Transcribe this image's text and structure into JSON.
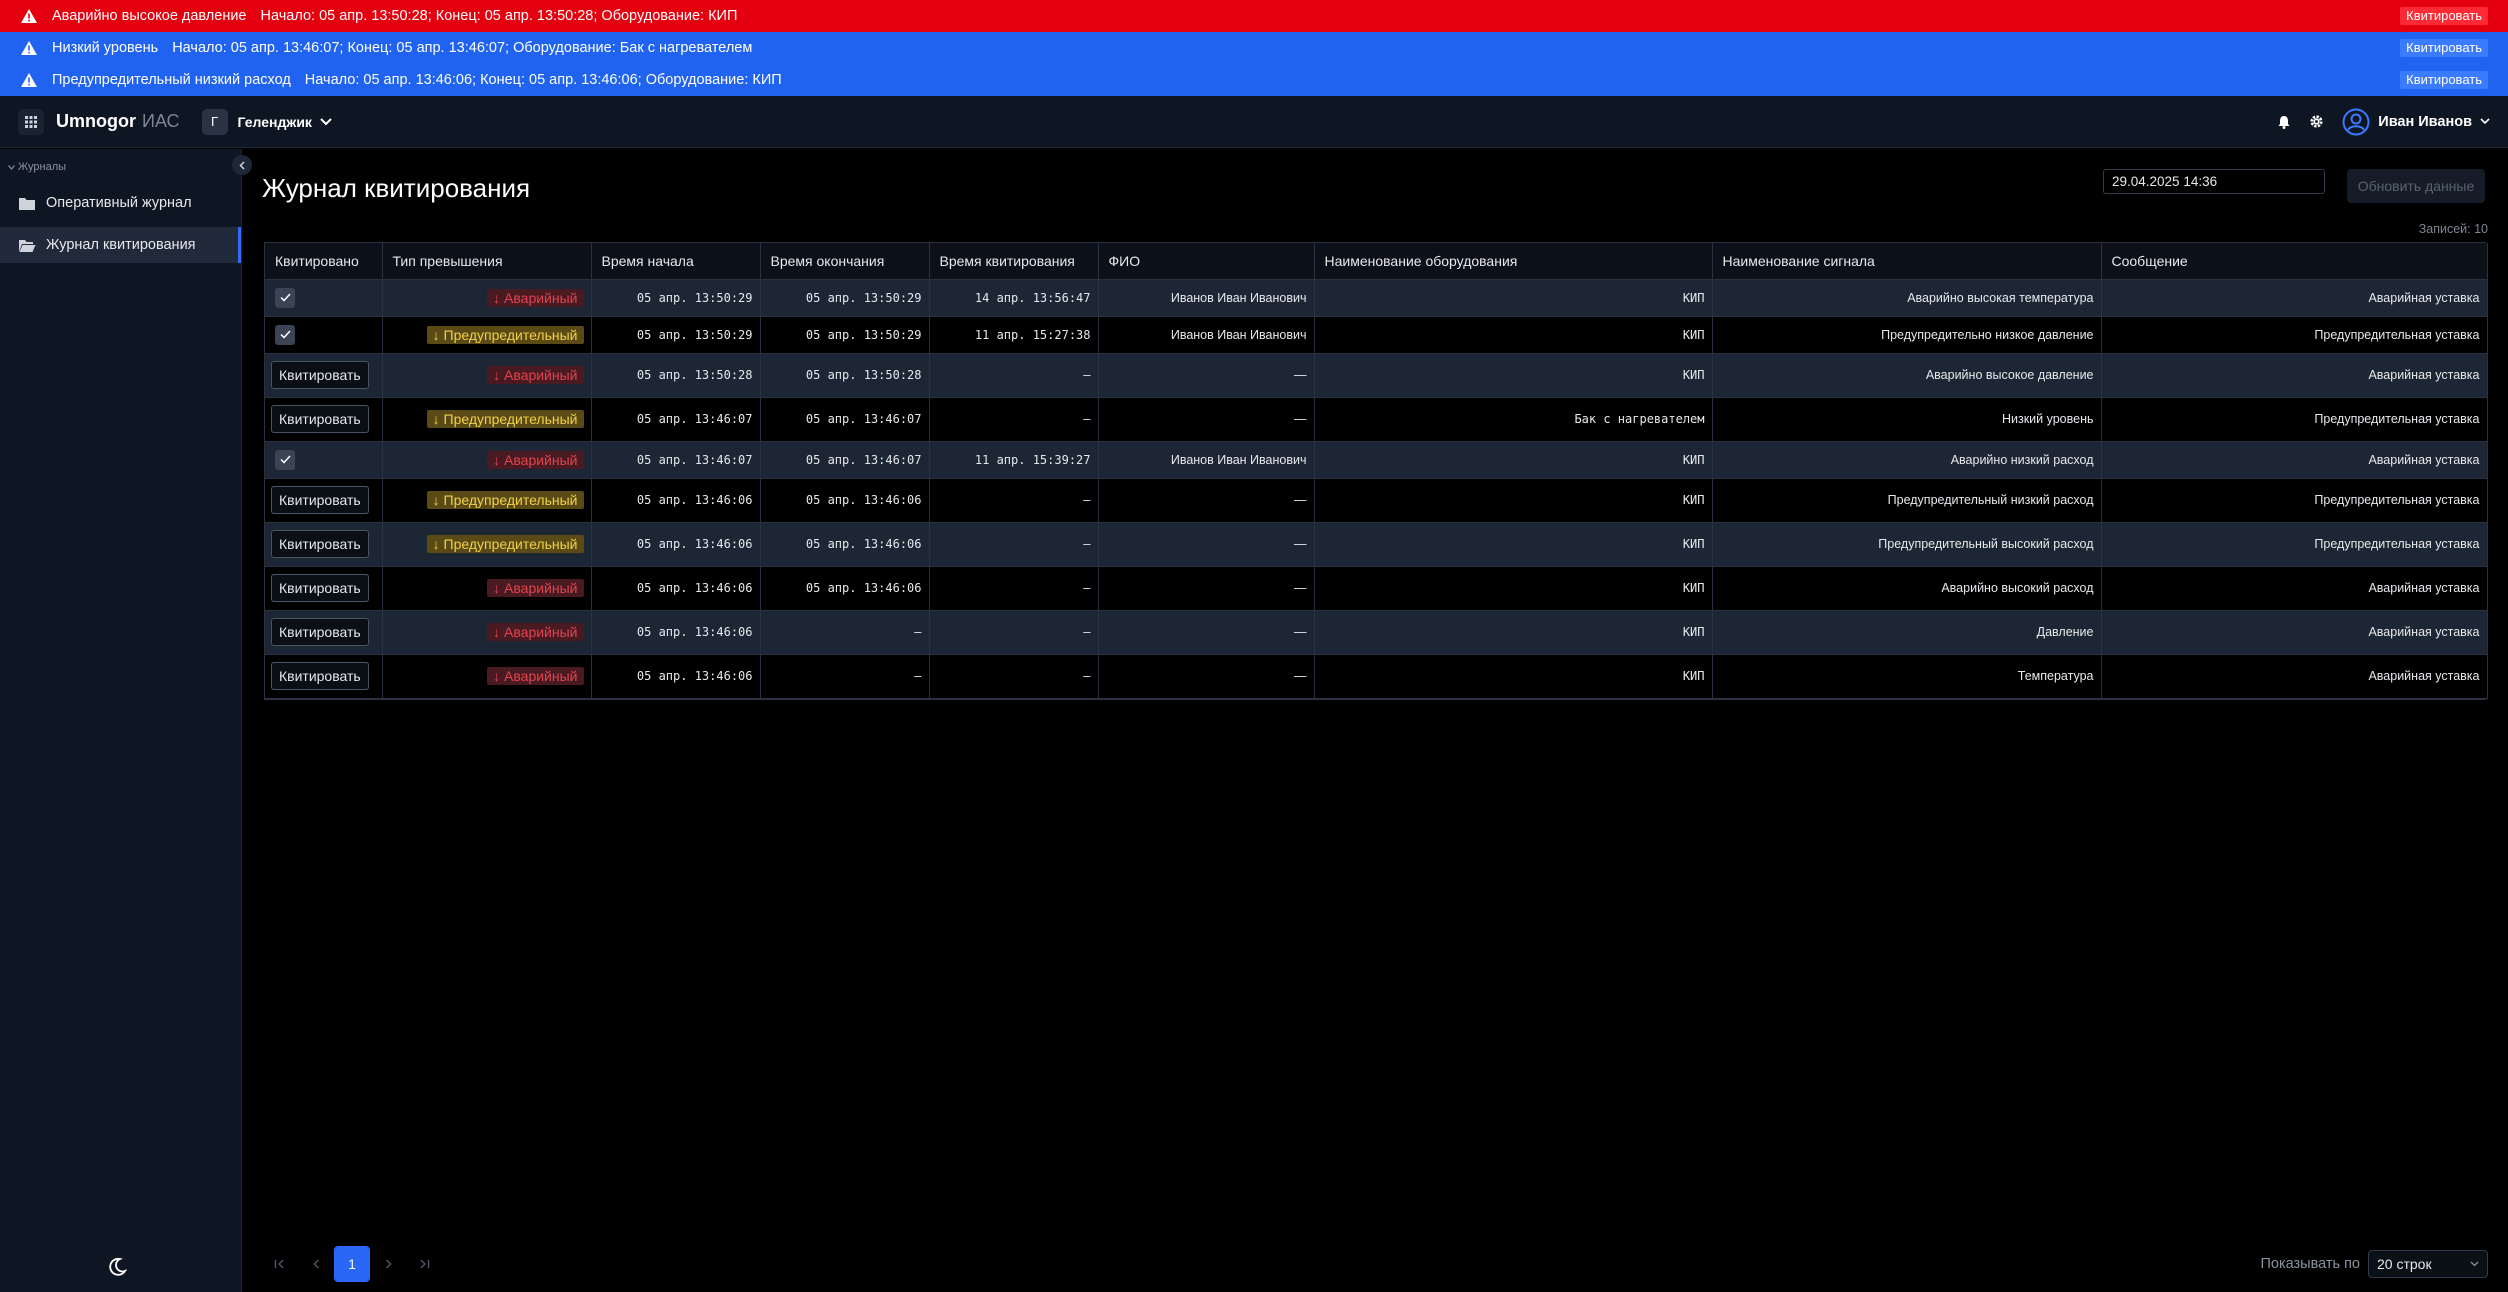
{
  "alerts": [
    {
      "title": "Аварийно высокое давление",
      "details": "Начало: 05 апр. 13:50:28; Конец: 05 апр. 13:50:28; Оборудование: КИП",
      "ack": "Квитировать",
      "color": "#e4000f"
    },
    {
      "title": "Низкий уровень",
      "details": "Начало: 05 апр. 13:46:07; Конец: 05 апр. 13:46:07; Оборудование: Бак с нагревателем",
      "ack": "Квитировать",
      "color": "#1f63f0"
    },
    {
      "title": "Предупредительный низкий расход",
      "details": "Начало: 05 апр. 13:46:06; Конец: 05 апр. 13:46:06; Оборудование: КИП",
      "ack": "Квитировать",
      "color": "#1f63f0"
    }
  ],
  "header": {
    "brand": "Umnogor",
    "brand_sub": "ИАС",
    "location_initial": "Г",
    "location": "Геленджик",
    "user": "Иван Иванов"
  },
  "sidebar": {
    "group": "Журналы",
    "items": [
      {
        "label": "Оперативный журнал",
        "icon": "folder-icon"
      },
      {
        "label": "Журнал квитирования",
        "icon": "folder-open-icon",
        "active": true
      }
    ]
  },
  "main": {
    "title": "Журнал квитирования",
    "date": "29.04.2025 14:36",
    "refresh": "Обновить данные",
    "records": "Записей: 10"
  },
  "table": {
    "columns": [
      "Квитировано",
      "Тип превышения",
      "Время начала",
      "Время окончания",
      "Время квитирования",
      "ФИО",
      "Наименование оборудования",
      "Наименование сигнала",
      "Сообщение"
    ],
    "ack_label": "Квитировать",
    "rows": [
      {
        "acked": true,
        "type": "Аварийный",
        "kind": "alarm",
        "start": "05 апр. 13:50:29",
        "end": "05 апр. 13:50:29",
        "ack_time": "14 апр. 13:56:47",
        "fio": "Иванов Иван Иванович",
        "equipment": "КИП",
        "signal": "Аварийно высокая температура",
        "message": "Аварийная уставка"
      },
      {
        "acked": true,
        "type": "Предупредительный",
        "kind": "warn",
        "start": "05 апр. 13:50:29",
        "end": "05 апр. 13:50:29",
        "ack_time": "11 апр. 15:27:38",
        "fio": "Иванов Иван Иванович",
        "equipment": "КИП",
        "signal": "Предупредительно низкое давление",
        "message": "Предупредительная уставка"
      },
      {
        "acked": false,
        "type": "Аварийный",
        "kind": "alarm",
        "start": "05 апр. 13:50:28",
        "end": "05 апр. 13:50:28",
        "ack_time": "—",
        "fio": "—",
        "equipment": "КИП",
        "signal": "Аварийно высокое давление",
        "message": "Аварийная уставка"
      },
      {
        "acked": false,
        "type": "Предупредительный",
        "kind": "warn",
        "start": "05 апр. 13:46:07",
        "end": "05 апр. 13:46:07",
        "ack_time": "—",
        "fio": "—",
        "equipment": "Бак с нагревателем",
        "signal": "Низкий уровень",
        "message": "Предупредительная уставка"
      },
      {
        "acked": true,
        "type": "Аварийный",
        "kind": "alarm",
        "start": "05 апр. 13:46:07",
        "end": "05 апр. 13:46:07",
        "ack_time": "11 апр. 15:39:27",
        "fio": "Иванов Иван Иванович",
        "equipment": "КИП",
        "signal": "Аварийно низкий расход",
        "message": "Аварийная уставка"
      },
      {
        "acked": false,
        "type": "Предупредительный",
        "kind": "warn",
        "start": "05 апр. 13:46:06",
        "end": "05 апр. 13:46:06",
        "ack_time": "—",
        "fio": "—",
        "equipment": "КИП",
        "signal": "Предупредительный низкий расход",
        "message": "Предупредительная уставка"
      },
      {
        "acked": false,
        "type": "Предупредительный",
        "kind": "warn",
        "start": "05 апр. 13:46:06",
        "end": "05 апр. 13:46:06",
        "ack_time": "—",
        "fio": "—",
        "equipment": "КИП",
        "signal": "Предупредительный высокий расход",
        "message": "Предупредительная уставка"
      },
      {
        "acked": false,
        "type": "Аварийный",
        "kind": "alarm",
        "start": "05 апр. 13:46:06",
        "end": "05 апр. 13:46:06",
        "ack_time": "—",
        "fio": "—",
        "equipment": "КИП",
        "signal": "Аварийно высокий расход",
        "message": "Аварийная уставка"
      },
      {
        "acked": false,
        "type": "Аварийный",
        "kind": "alarm",
        "start": "05 апр. 13:46:06",
        "end": "—",
        "ack_time": "—",
        "fio": "—",
        "equipment": "КИП",
        "signal": "Давление",
        "message": "Аварийная уставка"
      },
      {
        "acked": false,
        "type": "Аварийный",
        "kind": "alarm",
        "start": "05 апр. 13:46:06",
        "end": "—",
        "ack_time": "—",
        "fio": "—",
        "equipment": "КИП",
        "signal": "Температура",
        "message": "Аварийная уставка"
      }
    ]
  },
  "pagination": {
    "current_page": "1",
    "per_page_label": "Показывать по",
    "per_page": "20 строк"
  }
}
